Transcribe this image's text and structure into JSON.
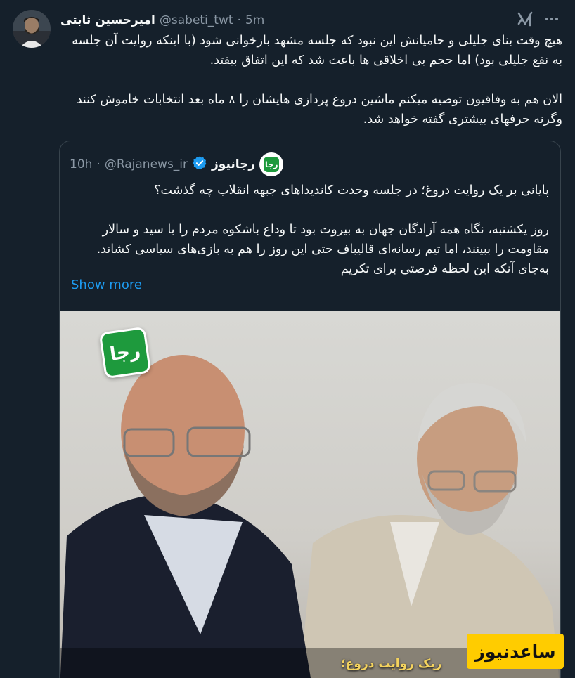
{
  "tweet": {
    "display_name": "امیرحسین ثابتی",
    "handle": "@sabeti_twt",
    "separator": "·",
    "time": "5m",
    "paragraphs": [
      "هیچ وقت بنای جلیلی و حامیانش این نبود که جلسه مشهد بازخوانی شود (با اینکه روایت آن جلسه به نفع جلیلی بود) اما حجم بی اخلاقی ها باعث شد که این اتفاق بیفتد.",
      "الان هم به وفاقیون توصیه میکنم ماشین دروغ پردازی هایشان را ۸ ماه بعد انتخابات خاموش کنند وگرنه حرفهای بیشتری گفته خواهد شد."
    ]
  },
  "quote": {
    "display_name": "رجانیوز",
    "handle": "@Rajanews_ir",
    "separator": "·",
    "time": "10h",
    "avatar_text": "رجا",
    "paragraphs": [
      "پایانی بر یک روایت دروغ؛ در جلسه وحدت کاندیداهای جبهه انقلاب چه گذشت؟",
      "روز یکشنبه، نگاه همه آزادگان جهان به بیروت بود تا وداع باشکوه مردم را با سید و سالار مقاومت را ببینند، اما تیم رسانه‌ای قالیباف حتی این روز را هم به بازی‌های سیاسی کشاند. به‌جای آنکه این لحظه فرصتی برای تکریم"
    ],
    "show_more": "Show more",
    "media": {
      "logo_text": "رجا",
      "caption": "ریک روایت دروغ؛"
    }
  },
  "watermark": "ساعدنیوز",
  "colors": {
    "background": "#15202b",
    "text": "#f7f9f9",
    "muted": "#8b98a5",
    "link": "#1d9bf0",
    "border": "#38444d",
    "brand_green": "#1e9a3d",
    "watermark": "#ffcc00"
  },
  "icons": [
    "grok-icon",
    "more-icon",
    "verified-icon"
  ]
}
